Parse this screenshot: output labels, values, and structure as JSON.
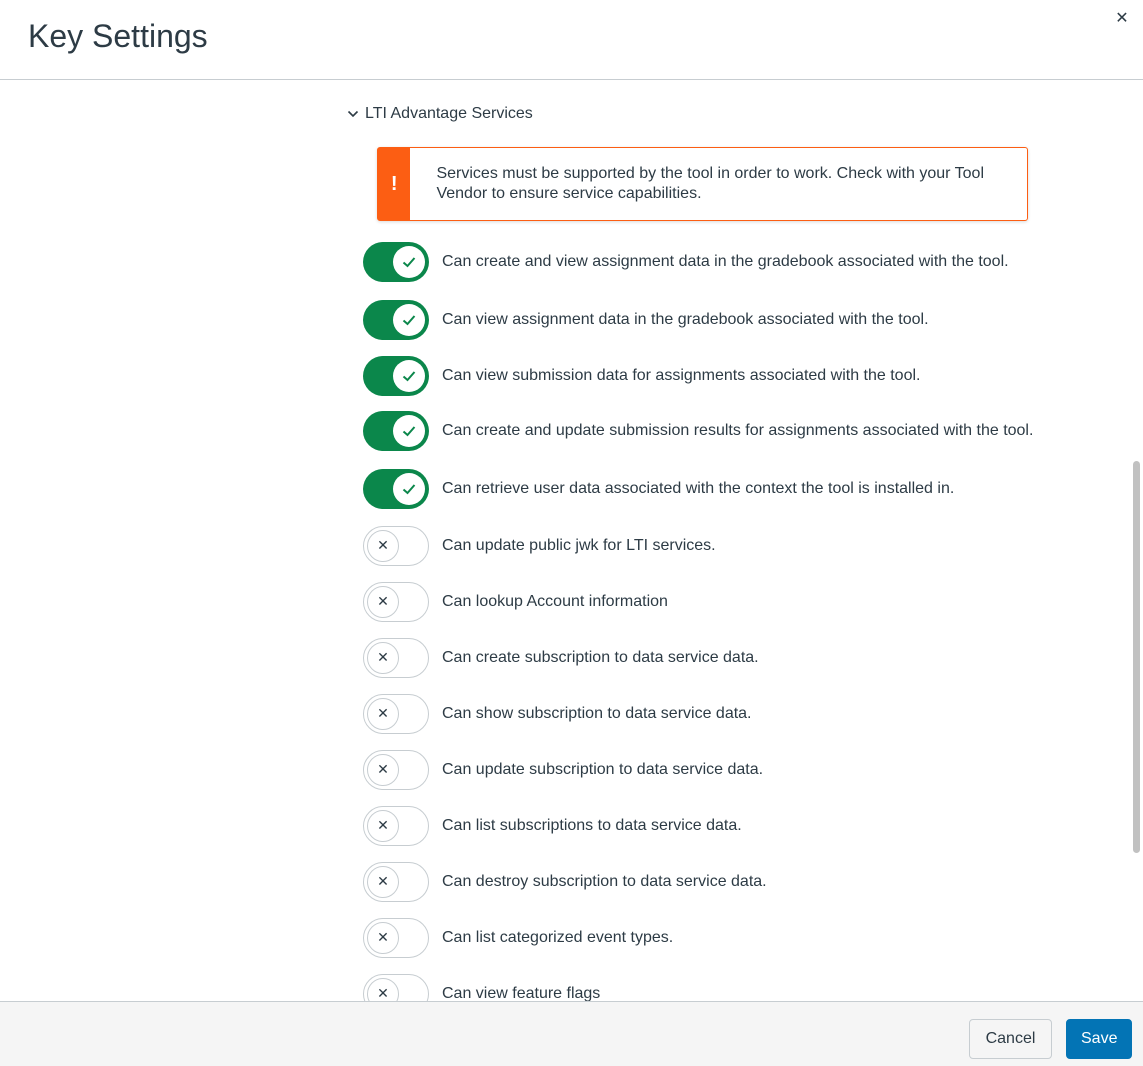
{
  "modal": {
    "title": "Key Settings",
    "close_icon": "close-icon"
  },
  "section": {
    "label": "LTI Advantage Services",
    "expanded": true
  },
  "alert": {
    "icon": "warning-icon",
    "color": "#fc5e13",
    "message": "Services must be supported by the tool in order to work. Check with your Tool Vendor to ensure service capabilities."
  },
  "services": [
    {
      "label": "Can create and view assignment data in the gradebook associated with the tool.",
      "enabled": true
    },
    {
      "label": "Can view assignment data in the gradebook associated with the tool.",
      "enabled": true
    },
    {
      "label": "Can view submission data for assignments associated with the tool.",
      "enabled": true
    },
    {
      "label": "Can create and update submission results for assignments associated with the tool.",
      "enabled": true
    },
    {
      "label": "Can retrieve user data associated with the context the tool is installed in.",
      "enabled": true
    },
    {
      "label": "Can update public jwk for LTI services.",
      "enabled": false
    },
    {
      "label": "Can lookup Account information",
      "enabled": false
    },
    {
      "label": "Can create subscription to data service data.",
      "enabled": false
    },
    {
      "label": "Can show subscription to data service data.",
      "enabled": false
    },
    {
      "label": "Can update subscription to data service data.",
      "enabled": false
    },
    {
      "label": "Can list subscriptions to data service data.",
      "enabled": false
    },
    {
      "label": "Can destroy subscription to data service data.",
      "enabled": false
    },
    {
      "label": "Can list categorized event types.",
      "enabled": false
    },
    {
      "label": "Can view feature flags",
      "enabled": false
    }
  ],
  "colors": {
    "on": "#0b874b",
    "off_border": "#c7cdd1",
    "primary": "#0374b5"
  },
  "footer": {
    "cancel_label": "Cancel",
    "save_label": "Save"
  }
}
